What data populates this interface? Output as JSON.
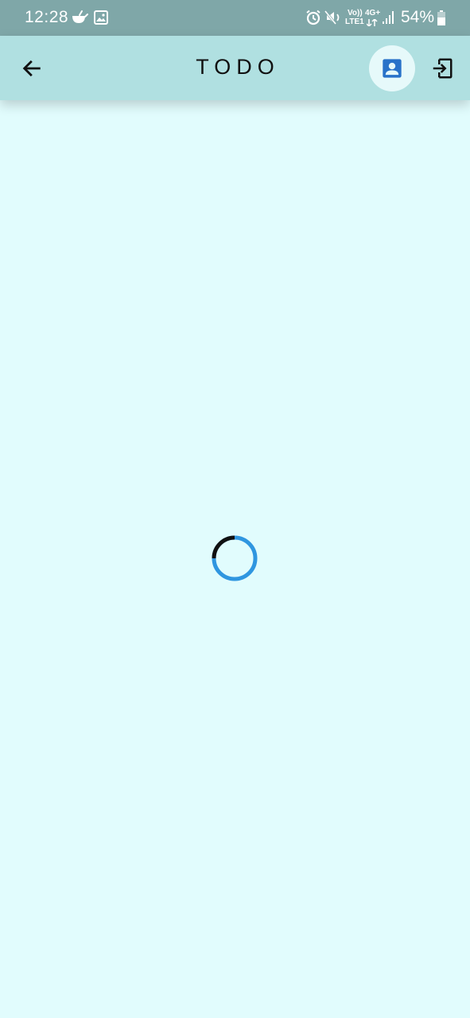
{
  "status_bar": {
    "time": "12:28",
    "volte_label": "Vo))",
    "lte_label": "LTE1",
    "network_label": "4G+",
    "battery_percent": "54%",
    "icons": [
      "teapot-icon",
      "gallery-icon",
      "alarm-icon",
      "mute-icon",
      "signal-icon",
      "battery-icon"
    ]
  },
  "app_bar": {
    "title": "TODO",
    "back_icon": "arrow-left-icon",
    "profile_icon": "account-box-icon",
    "logout_icon": "logout-icon"
  },
  "content": {
    "loading": true
  },
  "colors": {
    "status_bar": "#7fa7a8",
    "app_bar": "#b0e0e1",
    "background": "#e1fcfd",
    "accent": "#2f96e0",
    "profile_bg": "#e6f9fa"
  }
}
